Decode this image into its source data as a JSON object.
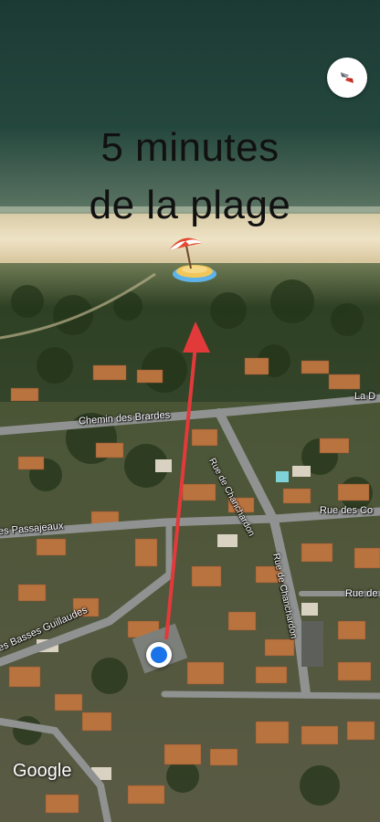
{
  "overlay": {
    "title_line_1": "5 minutes",
    "title_line_2": "de la plage"
  },
  "streets": {
    "chemin_des_brardes": "Chemin des Brardes",
    "rue_de_chanchardon_upper": "Rue de Chanchardon",
    "rue_de_chanchardon_lower": "Rue de Chanchardon",
    "rue_des_co": "Rue des Co",
    "rue_de": "Rue de",
    "la_d": "La D",
    "passajeaux": "es Passajeaux",
    "basses_guillaudes": "es Basses Guillaudes"
  },
  "logo": "Google",
  "icons": {
    "beach": "beach-umbrella-icon",
    "compass": "compass-icon",
    "location": "current-location-icon"
  },
  "colors": {
    "arrow": "#e23a3a",
    "location_dot": "#1a73e8",
    "compass_red": "#d93025",
    "sea": "#1f3a32",
    "sand": "#e8d9b8"
  }
}
